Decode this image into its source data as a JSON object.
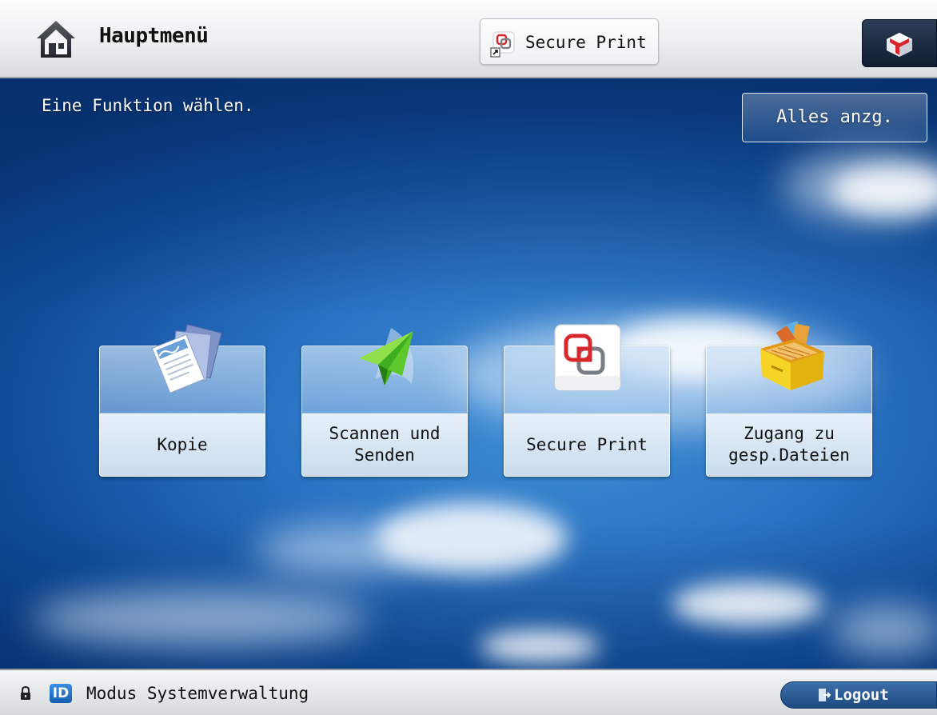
{
  "header": {
    "title": "Hauptmenü",
    "shortcut_label": "Secure Print"
  },
  "main": {
    "prompt": "Eine Funktion wählen.",
    "show_all_label": "Alles anzg.",
    "tiles": [
      {
        "label": "Kopie",
        "icon": "copy-icon"
      },
      {
        "label": "Scannen und\nSenden",
        "icon": "scan-send-icon"
      },
      {
        "label": "Secure Print",
        "icon": "secure-print-icon"
      },
      {
        "label": "Zugang zu\ngesp.Dateien",
        "icon": "stored-files-icon"
      }
    ]
  },
  "footer": {
    "id_badge": "ID",
    "mode_label": "Modus Systemverwaltung",
    "logout_label": "Logout"
  },
  "colors": {
    "sky": "#2a72c2",
    "header_bg": "#eceef0",
    "tile_label_bg": "#e6f0fa",
    "logout": "#1d4a80"
  }
}
